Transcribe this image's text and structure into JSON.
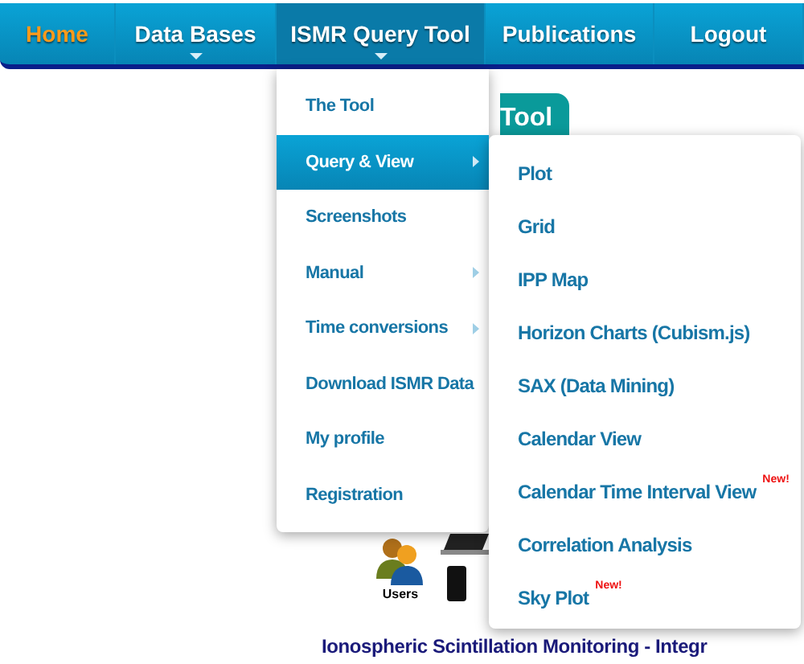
{
  "nav": [
    {
      "label": "Home",
      "selected": true,
      "open": false,
      "has_caret": false
    },
    {
      "label": "Data Bases",
      "selected": false,
      "open": false,
      "has_caret": true
    },
    {
      "label": "ISMR Query Tool",
      "selected": false,
      "open": true,
      "has_caret": true
    },
    {
      "label": "Publications",
      "selected": false,
      "open": false,
      "has_caret": false
    },
    {
      "label": "Logout",
      "selected": false,
      "open": false,
      "has_caret": false
    }
  ],
  "dropdown": [
    {
      "label": "The Tool",
      "selected": false,
      "has_submenu": false
    },
    {
      "label": "Query & View",
      "selected": true,
      "has_submenu": true
    },
    {
      "label": "Screenshots",
      "selected": false,
      "has_submenu": false
    },
    {
      "label": "Manual",
      "selected": false,
      "has_submenu": true
    },
    {
      "label": "Time conversions",
      "selected": false,
      "has_submenu": true
    },
    {
      "label": "Download ISMR Data",
      "selected": false,
      "has_submenu": false
    },
    {
      "label": "My profile",
      "selected": false,
      "has_submenu": false
    },
    {
      "label": "Registration",
      "selected": false,
      "has_submenu": false
    }
  ],
  "submenu": [
    {
      "label": "Plot"
    },
    {
      "label": "Grid"
    },
    {
      "label": "IPP Map"
    },
    {
      "label": "Horizon Charts (Cubism.js)"
    },
    {
      "label": "SAX (Data Mining)"
    },
    {
      "label": "Calendar View"
    },
    {
      "label": "Calendar Time Interval View",
      "badge": "New!"
    },
    {
      "label": "Correlation Analysis"
    },
    {
      "label": "Sky Plot",
      "badge": "New!"
    }
  ],
  "page": {
    "tab": "Tool",
    "users_label": "Users",
    "heading": "Ionospheric Scintillation Monitoring - Integr"
  }
}
